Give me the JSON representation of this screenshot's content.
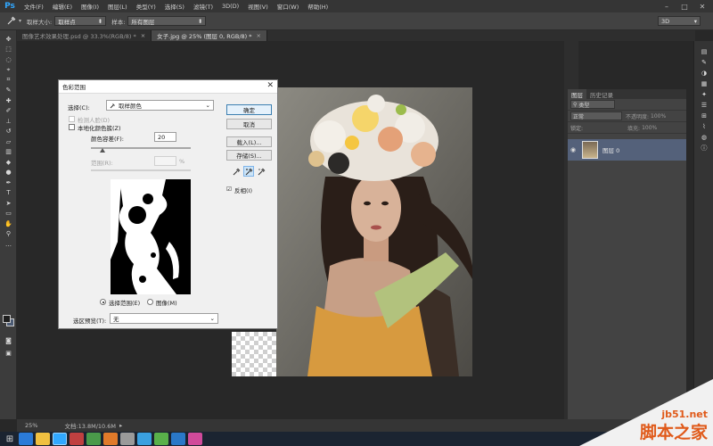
{
  "app": {
    "logo": "Ps"
  },
  "menu": [
    "文件(F)",
    "编辑(E)",
    "图像(I)",
    "图层(L)",
    "类型(Y)",
    "选择(S)",
    "滤镜(T)",
    "3D(D)",
    "视图(V)",
    "窗口(W)",
    "帮助(H)"
  ],
  "window_controls": {
    "minimize": "–",
    "maximize": "□",
    "close": "✕"
  },
  "options": {
    "sample_size_label": "取样大小:",
    "sample_size_value": "取样点",
    "sample_label": "样本:",
    "sample_value": "所有图层",
    "workspace": "3D"
  },
  "tabs": [
    {
      "label": "图像艺术效果处理.psd @ 33.3%(RGB/8) *",
      "close": "×"
    },
    {
      "label": "女子.jpg @ 25% (图层 0, RGB/8) *",
      "close": "×"
    }
  ],
  "dialog": {
    "title": "色彩范围",
    "close": "✕",
    "select_label": "选择(C):",
    "select_value": "取样颜色",
    "detect_faces": "检测人脸(D)",
    "localized": "本地化颜色簇(Z)",
    "fuzziness_label": "颜色容差(F):",
    "fuzziness_value": "20",
    "range_label": "范围(R):",
    "range_unit": "%",
    "radio_selection": "选择范围(E)",
    "radio_image": "图像(M)",
    "preview_label": "选区预览(T):",
    "preview_value": "无",
    "ok": "确定",
    "cancel": "取消",
    "load": "载入(L)...",
    "save": "存储(S)...",
    "invert": "反相(I)",
    "invert_check": "☑"
  },
  "layers_panel": {
    "tabs": [
      "图层",
      "历史记录"
    ],
    "filter": "类型",
    "blend": "正常",
    "opacity_label": "不透明度:",
    "opacity_value": "100%",
    "lock_label": "锁定:",
    "fill_label": "填充:",
    "fill_value": "100%",
    "layer_name": "图层 0"
  },
  "status": {
    "zoom": "25%",
    "doc": "文档:13.8M/10.6M"
  },
  "watermark": {
    "url": "jb51.net",
    "name": "脚本之家"
  },
  "colors": {
    "ps_blue": "#31a8ff",
    "layer_selected": "#54617a",
    "watermark": "#e05a1a"
  }
}
